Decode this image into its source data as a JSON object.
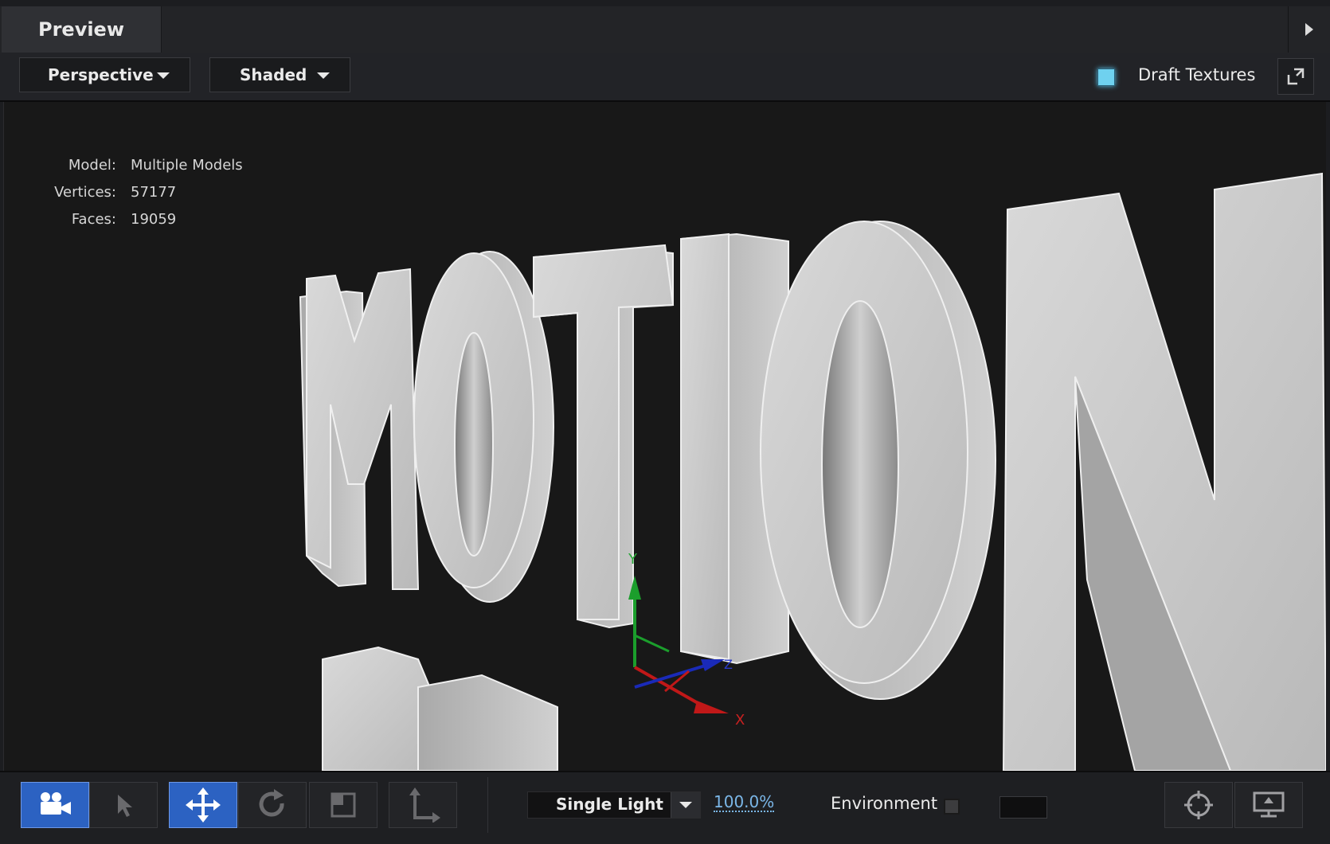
{
  "tab": {
    "title": "Preview",
    "arrow_icon": "play-right-icon"
  },
  "toolbar": {
    "view_mode": "Perspective",
    "shading_mode": "Shaded",
    "draft_textures_label": "Draft Textures",
    "draft_textures_checked": true,
    "draft_textures_color": "#6fd1ef"
  },
  "viewport": {
    "stats": [
      {
        "key": "Model:",
        "value": "Multiple Models"
      },
      {
        "key": "Vertices:",
        "value": "57177"
      },
      {
        "key": "Faces:",
        "value": "19059"
      }
    ],
    "scene_text": "MOTION",
    "gizmo": {
      "y_axis": "Y",
      "x_axis": "X",
      "z_axis": "Z"
    }
  },
  "bottom": {
    "tools": [
      {
        "name": "camera-tool",
        "icon": "video-camera-icon",
        "active": true
      },
      {
        "name": "select-tool",
        "icon": "arrow-pointer-icon",
        "active": false
      },
      {
        "name": "move-tool",
        "icon": "move-arrows-icon",
        "active": true
      },
      {
        "name": "rotate-tool",
        "icon": "rotate-icon",
        "active": false
      },
      {
        "name": "scale-tool",
        "icon": "scale-box-icon",
        "active": false
      },
      {
        "name": "axis-tool",
        "icon": "axis-corner-icon",
        "active": false
      }
    ],
    "lighting": "Single Light",
    "zoom": "100.0%",
    "environment_label": "Environment",
    "environment_checked": false,
    "accent_color": "#2c62c2"
  }
}
